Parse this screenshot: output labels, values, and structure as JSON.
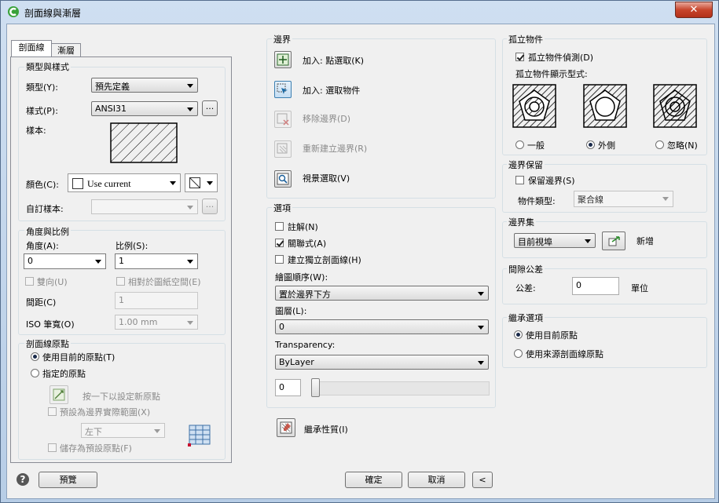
{
  "window": {
    "title": "剖面線與漸層",
    "close_glyph": "✕"
  },
  "tabs": [
    {
      "label": "剖面線"
    },
    {
      "label": "漸層"
    }
  ],
  "type_pattern": {
    "group": "類型與樣式",
    "type_label": "類型(Y):",
    "type_value": "預先定義",
    "pattern_label": "樣式(P):",
    "pattern_value": "ANSI31",
    "browse": "...",
    "swatch_label": "樣本:",
    "color_label": "顏色(C):",
    "color_value": "Use current",
    "custom_label": "自訂樣本:",
    "custom_value": "",
    "custom_browse": "..."
  },
  "angle_scale": {
    "group": "角度與比例",
    "angle_label": "角度(A):",
    "angle_value": "0",
    "scale_label": "比例(S):",
    "scale_value": "1",
    "double_label": "雙向(U)",
    "relative_label": "相對於圖紙空間(E)",
    "spacing_label": "間距(C)",
    "spacing_value": "1",
    "iso_label": "ISO 筆寬(O)",
    "iso_value": "1.00 mm"
  },
  "origin": {
    "group": "剖面線原點",
    "use_current": "使用目前的原點(T)",
    "specified": "指定的原點",
    "click_set": "按一下以設定新原點",
    "default_extents": "預設為邊界實際範圍(X)",
    "position_value": "左下",
    "store_default": "儲存為預設原點(F)"
  },
  "boundaries": {
    "group": "邊界",
    "add_pick": "加入: 點選取(K)",
    "add_select": "加入: 選取物件",
    "remove": "移除邊界(D)",
    "recreate": "重新建立邊界(R)",
    "view": "視景選取(V)"
  },
  "options": {
    "group": "選項",
    "annotative": "註解(N)",
    "associative": "關聯式(A)",
    "separate": "建立獨立剖面線(H)",
    "draw_order_label": "繪圖順序(W):",
    "draw_order_value": "置於邊界下方",
    "layer_label": "圖層(L):",
    "layer_value": "0",
    "transparency_label": "Transparency:",
    "transparency_value": "ByLayer",
    "transparency_number": "0",
    "transparency_level": 0
  },
  "inherit_props": "繼承性質(I)",
  "islands": {
    "group": "孤立物件",
    "detect": "孤立物件偵測(D)",
    "style_label": "孤立物件顯示型式:",
    "normal": "一般",
    "outer": "外側",
    "ignore": "忽略(N)"
  },
  "retain": {
    "group": "邊界保留",
    "retain_label": "保留邊界(S)",
    "objtype_label": "物件類型:",
    "objtype_value": "聚合線"
  },
  "boundary_set": {
    "group": "邊界集",
    "value": "目前視埠",
    "new_label": "新增"
  },
  "gap": {
    "group": "間隙公差",
    "tol_label": "公差:",
    "tol_value": "0",
    "unit": "單位"
  },
  "inherit_opts": {
    "group": "繼承選項",
    "use_current": "使用目前原點",
    "use_source": "使用來源剖面線原點"
  },
  "footer": {
    "help": "?",
    "preview": "預覽",
    "ok": "確定",
    "cancel": "取消",
    "collapse": "<"
  },
  "colors": {
    "accent": "#0b63b8",
    "titlebar": "#c2d7ee",
    "close": "#c7452c"
  }
}
